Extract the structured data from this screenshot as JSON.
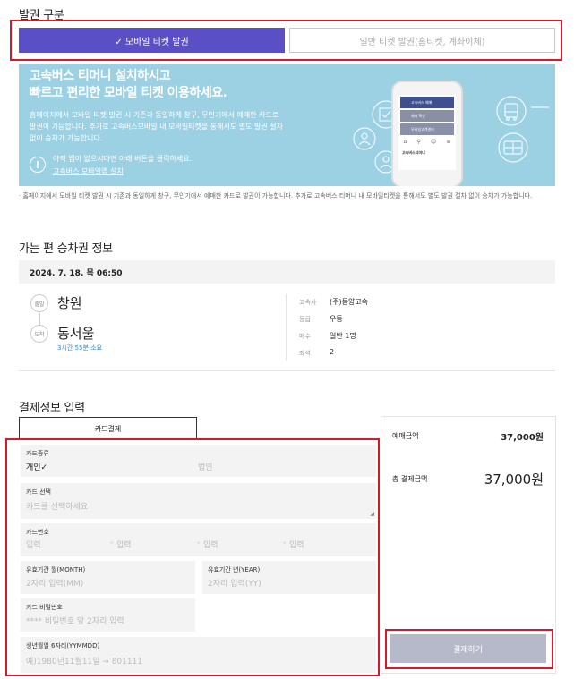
{
  "issue": {
    "title": "발권 구분",
    "mobile_label": "✓ 모바일 티켓 발권",
    "general_label": "일반 티켓 발권(홈티켓, 계좌이체)"
  },
  "banner": {
    "headline1": "고속버스 티머니 설치하시고",
    "headline2": "빠르고 편리한 모바일 티켓 이용하세요.",
    "desc1": "홈페이지에서 모바일 티켓 발권 시 기존과 동일하게 창구, 무인기에서 예매한 카드로",
    "desc2": "발권이 가능합니다. 추가로 고속버스모바일 내 모바일티켓을 통해서도 별도 발권 절차",
    "desc3": "없이 승차가 가능합니다.",
    "notice_line": "아직 앱이 없으시다면 아래 버튼을 클릭하세요.",
    "install_link": "고속버스 모바일앱 설치",
    "phone_menu": [
      "고속버스 예매",
      "예매 확인",
      "모바일고객센터"
    ],
    "phone_app_name": "고속버스티머니"
  },
  "notice": "· 홈페이지에서 모바일 티켓 발권 시 기존과 동일하게 창구, 무인기에서 예매한 카드로 발권이 가능합니다. 추가로 고속버스 티머니 내 모바일티켓을 통해서도 별도 발권 절차 없이 승차가 가능합니다.",
  "ticket": {
    "title": "가는 편 승차권 정보",
    "datetime": "2024. 7. 18. 목 06:50",
    "depart_badge": "출발",
    "arrive_badge": "도착",
    "depart": "창원",
    "arrive": "동서울",
    "duration": "3시간 55분 소요",
    "info": [
      {
        "k": "고속사",
        "v": "(주)동양고속"
      },
      {
        "k": "등급",
        "v": "우등"
      },
      {
        "k": "매수",
        "v": "일반 1명"
      },
      {
        "k": "좌석",
        "v": "2"
      }
    ]
  },
  "payment": {
    "title": "결제정보 입력",
    "tab": "카드결제",
    "card_type_label": "카드종류",
    "card_personal": "개인✓",
    "card_corporate": "법인",
    "card_select_label": "카드 선택",
    "card_select_placeholder": "카드를 선택하세요",
    "card_number_label": "카드번호",
    "card_number_placeholder": "입력",
    "card_number_sep": "-",
    "exp_month_label": "유효기간 월(MONTH)",
    "exp_month_placeholder": "2자리 입력(MM)",
    "exp_year_label": "유효기간 년(YEAR)",
    "exp_year_placeholder": "2자리 입력(YY)",
    "password_label": "카드 비밀번호",
    "password_placeholder": "**** 비밀번호 앞 2자리 입력",
    "birth_label": "생년월일 6자리(YYMMDD)",
    "birth_placeholder": "예)1980년11월11일 → 801111"
  },
  "summary": {
    "booking_label": "예매금액",
    "booking_value": "37,000원",
    "total_label": "총 결제금액",
    "total_value": "37,000원",
    "pay_button": "결제하기"
  }
}
